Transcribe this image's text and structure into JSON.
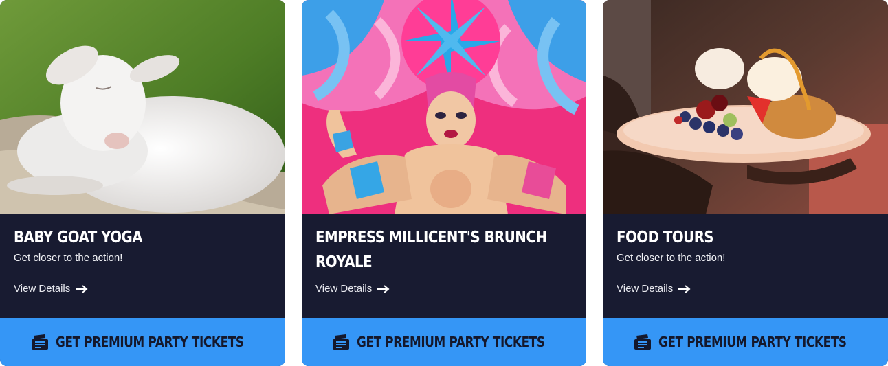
{
  "cards": [
    {
      "title": "BABY GOAT YOGA",
      "subtitle": "Get closer to the action!",
      "details_label": "View Details",
      "cta_label": "GET PREMIUM PARTY TICKETS",
      "photo": "baby-goat-photo"
    },
    {
      "title": "EMPRESS MILLICENT'S BRUNCH ROYALE",
      "subtitle": "",
      "details_label": "View Details",
      "cta_label": "GET PREMIUM PARTY TICKETS",
      "photo": "drag-queen-photo"
    },
    {
      "title": "FOOD TOURS",
      "subtitle": "Get closer to the action!",
      "details_label": "View Details",
      "cta_label": "GET PREMIUM PARTY TICKETS",
      "photo": "dessert-plate-photo"
    }
  ],
  "colors": {
    "card_bg": "#181b31",
    "cta_bg": "#3596f6",
    "cta_text": "#14182c",
    "text": "#ffffff"
  },
  "icons": {
    "details": "arrow-right-icon",
    "cta": "ticket-icon"
  }
}
